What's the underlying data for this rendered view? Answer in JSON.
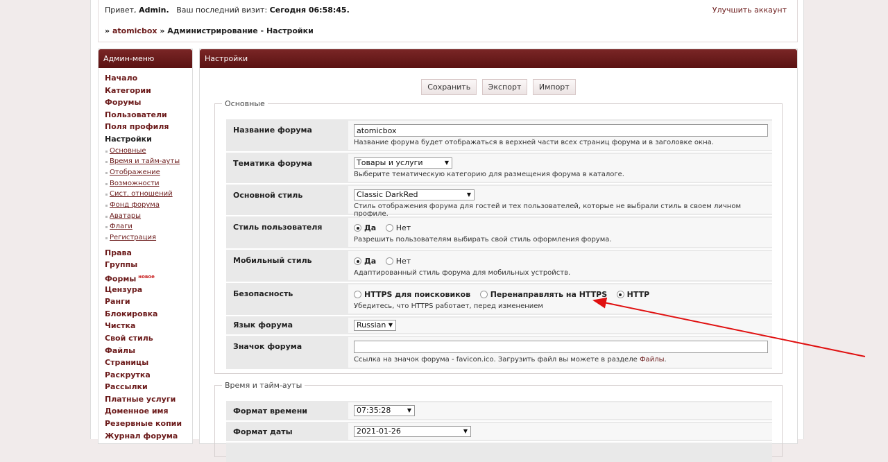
{
  "top": {
    "greet_prefix": "Привет,",
    "user": "Admin.",
    "last_visit_label": "Ваш последний визит:",
    "last_visit_value": "Сегодня 06:58:45.",
    "upgrade": "Улучшить аккаунт",
    "crumb_sep": "»",
    "crumb_site": "atomicbox",
    "crumb_rest": "» Администрирование - Настройки"
  },
  "sidebar": {
    "title": "Админ-меню",
    "items_top": [
      "Начало",
      "Категории",
      "Форумы",
      "Пользователи",
      "Поля профиля"
    ],
    "settings_label": "Настройки",
    "sub_items": [
      "Основные",
      "Время и тайм-ауты",
      "Отображение",
      "Возможности",
      "Сист. отношений",
      "Фонд форума",
      "Аватары",
      "Флаги",
      "Регистрация"
    ],
    "items_bottom": [
      "Права",
      "Группы",
      "Формы",
      "Цензура",
      "Ранги",
      "Блокировка",
      "Чистка",
      "Свой стиль",
      "Файлы",
      "Страницы",
      "Раскрутка",
      "Рассылки",
      "Платные услуги",
      "Доменное имя",
      "Резервные копии",
      "Журнал форума"
    ],
    "new_badge": "новое"
  },
  "main": {
    "title": "Настройки",
    "buttons": {
      "save": "Сохранить",
      "export": "Экспорт",
      "import": "Импорт"
    },
    "basic": {
      "legend": "Основные",
      "forum_name": {
        "label": "Название форума",
        "value": "atomicbox",
        "desc": "Название форума будет отображаться в верхней части всех страниц форума и в заголовке окна."
      },
      "forum_topic": {
        "label": "Тематика форума",
        "value": "Товары и услуги",
        "desc": "Выберите тематическую категорию для размещения форума в каталоге."
      },
      "main_style": {
        "label": "Основной стиль",
        "value": "Classic DarkRed",
        "desc": "Стиль отображения форума для гостей и тех пользователей, которые не выбрали стиль в своем личном профиле."
      },
      "user_style": {
        "label": "Стиль пользователя",
        "yes": "Да",
        "no": "Нет",
        "desc": "Разрешить пользователям выбирать свой стиль оформления форума."
      },
      "mobile_style": {
        "label": "Мобильный стиль",
        "yes": "Да",
        "no": "Нет",
        "desc": "Адаптированный стиль форума для мобильных устройств."
      },
      "security": {
        "label": "Безопасность",
        "opt1": "HTTPS для поисковиков",
        "opt2": "Перенаправлять на HTTPS",
        "opt3": "HTTP",
        "desc": "Убедитесь, что HTTPS работает, перед изменением"
      },
      "language": {
        "label": "Язык форума",
        "value": "Russian"
      },
      "favicon": {
        "label": "Значок форума",
        "value": "",
        "desc": "Ссылка на значок форума - favicon.ico. Загрузить файл вы можете в разделе",
        "desc_link": "Файлы",
        "desc_end": "."
      }
    },
    "time": {
      "legend": "Время и тайм-ауты",
      "time_format": {
        "label": "Формат времени",
        "value": "07:35:28"
      },
      "date_format": {
        "label": "Формат даты",
        "value": "2021-01-26"
      }
    }
  },
  "colors": {
    "accent": "#6b1a1a",
    "header": "#651b1b",
    "arrow": "#e01010"
  }
}
